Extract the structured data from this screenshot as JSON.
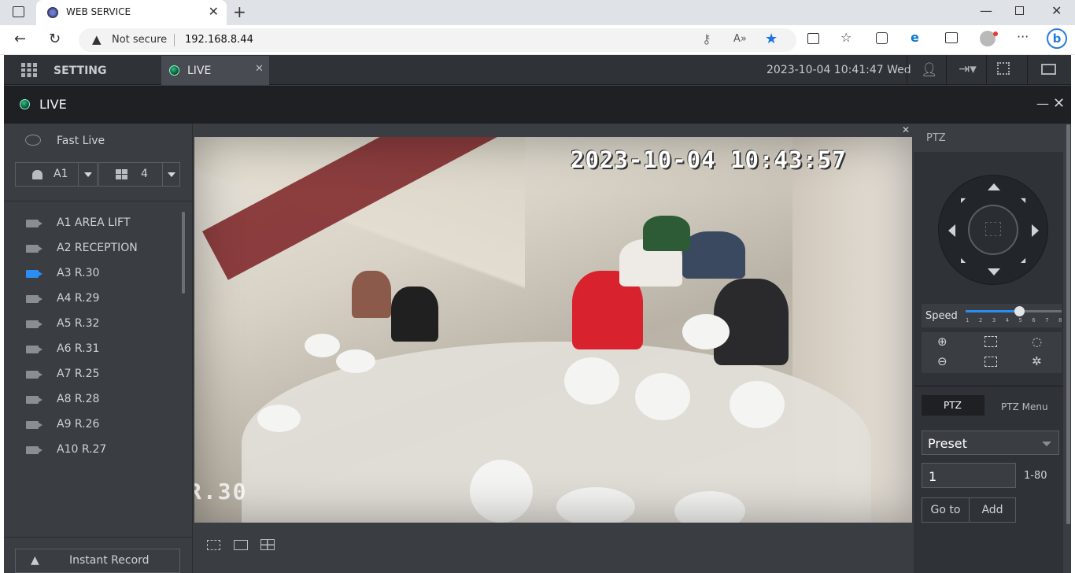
{
  "browser": {
    "tab_title": "WEB SERVICE",
    "security_label": "Not secure",
    "url": "192.168.8.44"
  },
  "app": {
    "nav": {
      "setting_label": "SETTING",
      "live_tab_label": "LIVE",
      "datetime": "2023-10-04 10:41:47 Wed"
    },
    "live_header": "LIVE",
    "left": {
      "fast_live_label": "Fast Live",
      "channel_select": "A1",
      "split_select": "4",
      "cameras": [
        {
          "label": "A1 AREA LIFT",
          "active": false
        },
        {
          "label": "A2 RECEPTION",
          "active": false
        },
        {
          "label": "A3 R.30",
          "active": true
        },
        {
          "label": "A4 R.29",
          "active": false
        },
        {
          "label": "A5 R.32",
          "active": false
        },
        {
          "label": "A6 R.31",
          "active": false
        },
        {
          "label": "A7 R.25",
          "active": false
        },
        {
          "label": "A8 R.28",
          "active": false
        },
        {
          "label": "A9 R.26",
          "active": false
        },
        {
          "label": "A10 R.27",
          "active": false
        }
      ],
      "instant_record_label": "Instant Record"
    },
    "video": {
      "osd_timestamp": "2023-10-04 10:43:57",
      "osd_channel": "R.30"
    },
    "ptz": {
      "title": "PTZ",
      "speed_label": "Speed",
      "speed_ticks": [
        "1",
        "2",
        "3",
        "4",
        "5",
        "6",
        "7",
        "8"
      ],
      "speed_value": 5,
      "tab_ptz": "PTZ",
      "tab_ptz_menu": "PTZ Menu",
      "preset_select": "Preset",
      "preset_value": "1",
      "preset_range": "1-80",
      "goto_label": "Go to",
      "add_label": "Add"
    }
  }
}
